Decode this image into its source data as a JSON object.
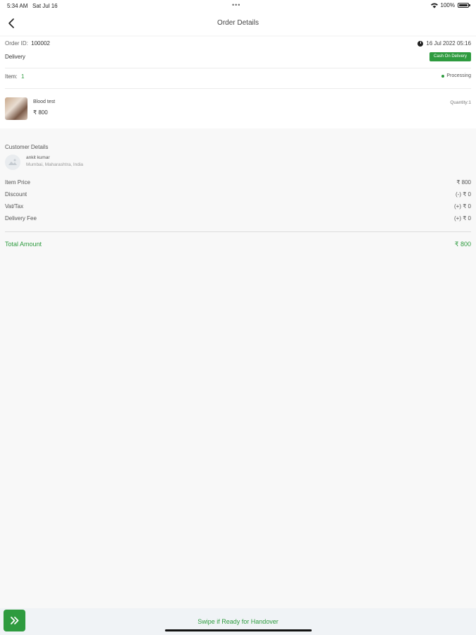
{
  "status_bar": {
    "time": "5:34 AM",
    "date": "Sat Jul 16",
    "dots": "•••",
    "battery": "100%"
  },
  "header": {
    "title": "Order Details",
    "back_icon": "chevron-left-icon"
  },
  "order": {
    "id_label": "Order ID:",
    "id_value": "100002",
    "datetime": "16 Jul 2022  05:16",
    "delivery_type": "Delivery",
    "payment_badge": "Cash On Delivery",
    "items_label": "Item:",
    "items_count": "1",
    "status": "Processing"
  },
  "product": {
    "name": "Blood test",
    "price": "₹ 800",
    "quantity": "Quantity:1"
  },
  "customer": {
    "heading": "Customer Details",
    "name": "ankit kumar",
    "location": "Mumbai, Maharashtra, India"
  },
  "summary": {
    "item_price_label": "Item Price",
    "item_price_value": "₹ 800",
    "discount_label": "Discount",
    "discount_value": "(-) ₹ 0",
    "vat_label": "Vat/Tax",
    "vat_value": "(+) ₹ 0",
    "delivery_fee_label": "Delivery Fee",
    "delivery_fee_value": "(+) ₹ 0",
    "total_label": "Total Amount",
    "total_value": "₹ 800"
  },
  "bottom": {
    "swipe_label": "Swipe if Ready for Handover"
  },
  "colors": {
    "accent": "#2e9b3f",
    "background": "#f8f8f8"
  }
}
